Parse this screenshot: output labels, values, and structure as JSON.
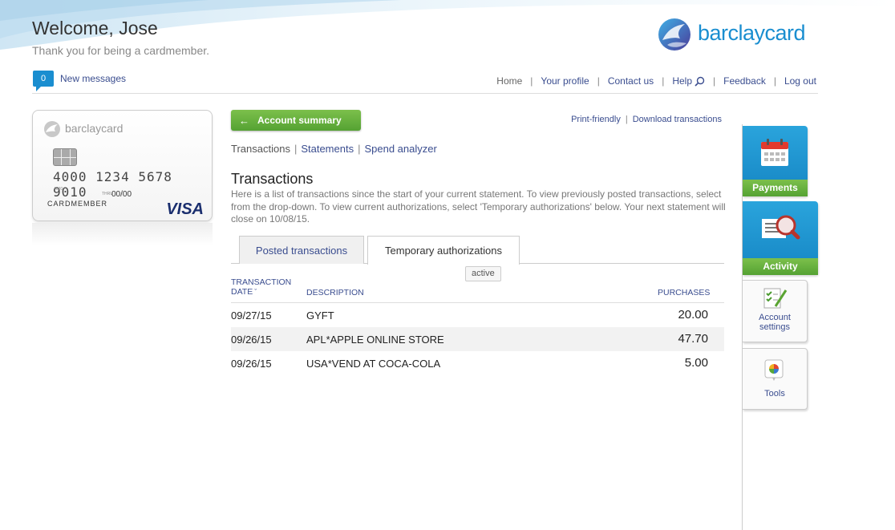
{
  "header": {
    "welcome": "Welcome, Jose",
    "subtitle": "Thank you for being a cardmember.",
    "brand": "barclaycard",
    "messages_count": "0",
    "messages_label": "New messages"
  },
  "topnav": {
    "home": "Home",
    "profile": "Your profile",
    "contact": "Contact us",
    "help": "Help",
    "feedback": "Feedback",
    "logout": "Log out"
  },
  "card": {
    "brand": "barclaycard",
    "number": "4000 1234 5678 9010",
    "small_digits": "4000",
    "thru_label": "THRU",
    "expiry": "00/00",
    "member": "CARDMEMBER",
    "network": "VISA"
  },
  "main": {
    "back_button": "Account summary",
    "print": "Print-friendly",
    "download": "Download transactions",
    "subnav": {
      "transactions": "Transactions",
      "statements": "Statements",
      "spend": "Spend analyzer"
    },
    "title": "Transactions",
    "description": "Here is a list of transactions since the start of your current statement. To view previously posted transactions, select from the drop-down. To view current authorizations, select 'Temporary authorizations' below. Your next statement will close on 10/08/15.",
    "tabs": {
      "posted": "Posted transactions",
      "temporary": "Temporary authorizations"
    },
    "tooltip": "active",
    "columns": {
      "date_line1": "TRANSACTION",
      "date_line2": "DATE",
      "description": "DESCRIPTION",
      "purchases": "PURCHASES"
    },
    "rows": [
      {
        "date": "09/27/15",
        "description": "GYFT",
        "amount": "20.00"
      },
      {
        "date": "09/26/15",
        "description": "APL*APPLE ONLINE STORE",
        "amount": "47.70"
      },
      {
        "date": "09/26/15",
        "description": "USA*VEND AT COCA-COLA",
        "amount": "5.00"
      }
    ]
  },
  "sidebar": {
    "payments": "Payments",
    "activity": "Activity",
    "settings_line1": "Account",
    "settings_line2": "settings",
    "tools": "Tools"
  },
  "colors": {
    "brand_blue": "#1a8ed0",
    "link": "#3a4d8f",
    "green": "#62ac3b"
  }
}
